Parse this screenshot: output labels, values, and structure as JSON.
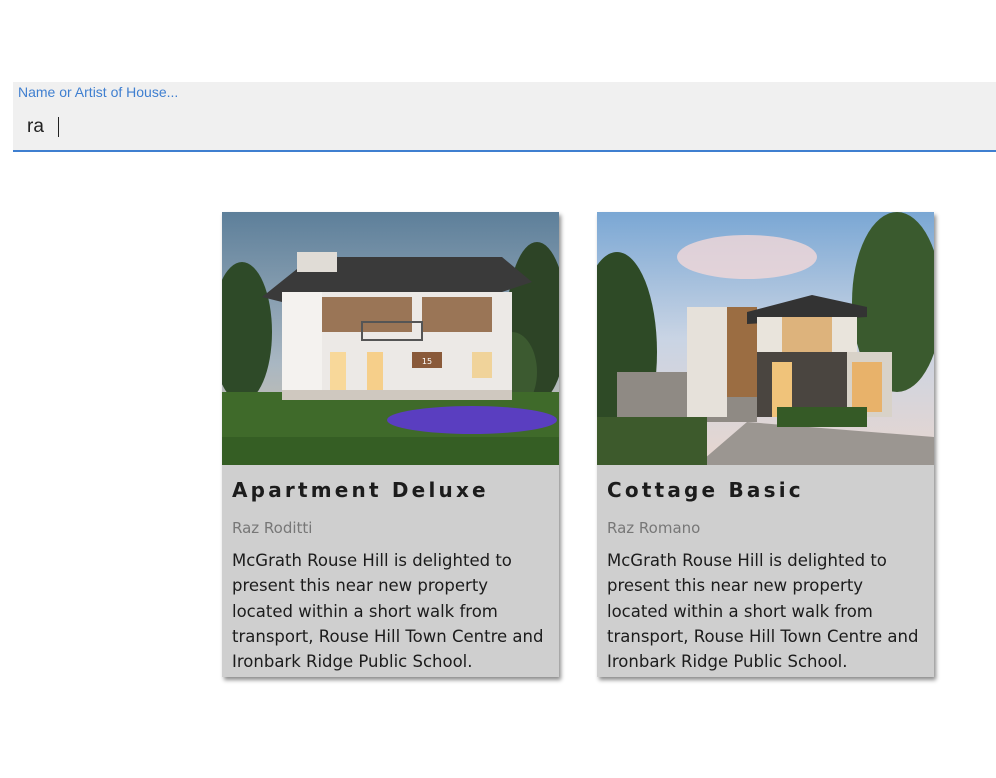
{
  "search": {
    "label": "Name or Artist of House...",
    "value": "ra"
  },
  "colors": {
    "accent": "#3f7fd0",
    "search_bg": "#f0f0f0",
    "card_bg": "#cfcfcf"
  },
  "results": [
    {
      "image_icon": "house-photo",
      "title": "Apartment Deluxe",
      "author": "Raz Roditti",
      "description": "McGrath Rouse Hill is delighted to present this near new property located within a short walk from transport, Rouse Hill Town Centre and Ironbark Ridge Public School."
    },
    {
      "image_icon": "house-photo",
      "title": "Cottage Basic",
      "author": "Raz Romano",
      "description": "McGrath Rouse Hill is delighted to present this near new property located within a short walk from transport, Rouse Hill Town Centre and Ironbark Ridge Public School."
    }
  ]
}
